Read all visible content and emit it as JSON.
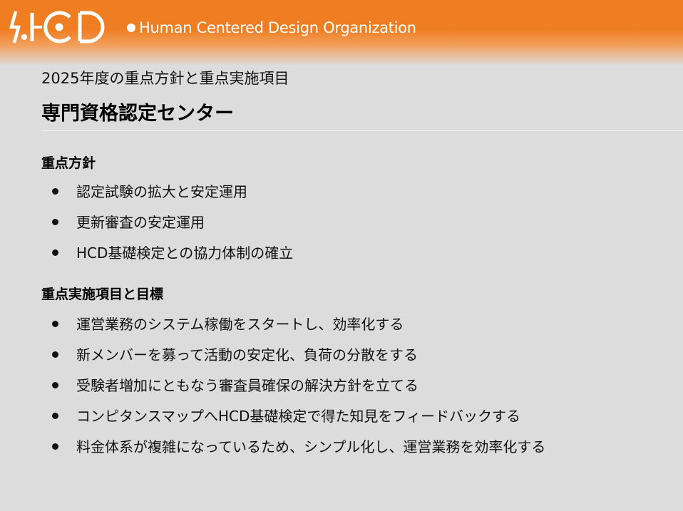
{
  "header": {
    "logo_text": "HCD",
    "org_name": "Human Centered Design Organization",
    "band_color": "#ef7d22"
  },
  "slide": {
    "subtitle": "2025年度の重点方針と重点実施項目",
    "title": "専門資格認定センター"
  },
  "sections": [
    {
      "heading": "重点方針",
      "items": [
        "認定試験の拡大と安定運用",
        "更新審査の安定運用",
        "HCD基礎検定との協力体制の確立"
      ]
    },
    {
      "heading": "重点実施項目と目標",
      "items": [
        "運営業務のシステム稼働をスタートし、効率化する",
        "新メンバーを募って活動の安定化、負荷の分散をする",
        "受験者増加にともなう審査員確保の解決方針を立てる",
        "コンピタンスマップへHCD基礎検定で得た知見をフィードバックする",
        "料金体系が複雑になっているため、シンプル化し、運営業務を効率化する"
      ]
    }
  ]
}
